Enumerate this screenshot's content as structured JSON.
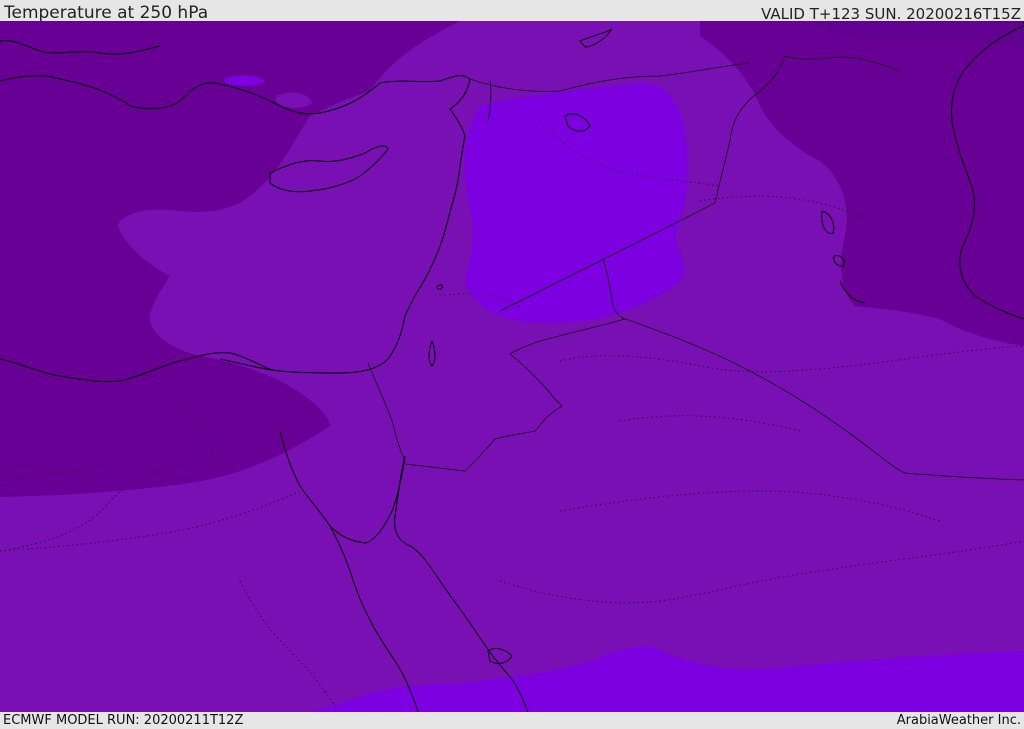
{
  "header": {
    "title": "Temperature at 250 hPa",
    "valid": "VALID T+123 SUN. 20200216T15Z"
  },
  "footer": {
    "model_run": "ECMWF MODEL RUN: 20200211T12Z",
    "credit": "ArabiaWeather Inc."
  },
  "map": {
    "field": "temperature",
    "level_hpa": 250,
    "colors": {
      "coldest": "#680096",
      "cold": "#7810b4",
      "mid": "#7a14b6",
      "warm": "#7d00e0",
      "coast_line": "#000000",
      "border_line": "#111111",
      "dotted_line": "#2b0a4a"
    }
  }
}
